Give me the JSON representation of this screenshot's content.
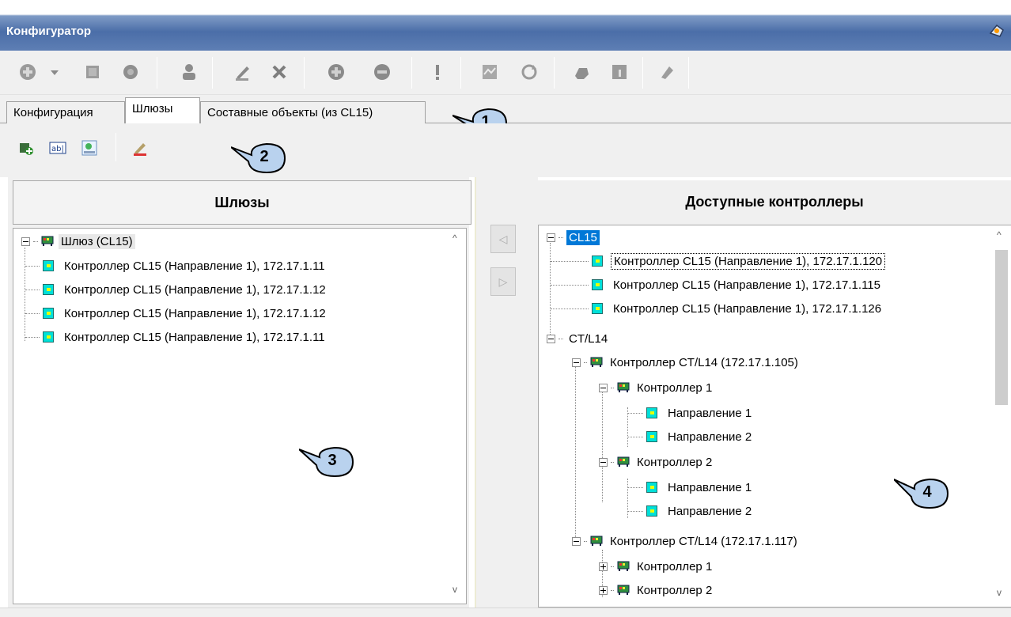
{
  "window": {
    "title": "Конфигуратор"
  },
  "tabs": [
    {
      "label": "Конфигурация",
      "active": false
    },
    {
      "label": "Шлюзы",
      "active": true
    },
    {
      "label": "Составные объекты (из CL15)",
      "active": false
    }
  ],
  "callouts": [
    "1",
    "2",
    "3",
    "4"
  ],
  "left_panel": {
    "header": "Шлюзы",
    "root": "Шлюз (CL15)",
    "items": [
      "Контроллер CL15 (Направление 1), 172.17.1.11",
      "Контроллер CL15 (Направление 1), 172.17.1.12",
      "Контроллер CL15 (Направление 1), 172.17.1.12",
      "Контроллер CL15 (Направление 1), 172.17.1.11"
    ]
  },
  "move_buttons": {
    "left": "◁",
    "right": "▷"
  },
  "right_panel": {
    "header": "Доступные контроллеры",
    "tree": {
      "cl15_group": "CL15",
      "cl15_items": [
        "Контроллер CL15 (Направление 1), 172.17.1.120",
        "Контроллер CL15 (Направление 1), 172.17.1.115",
        "Контроллер CL15 (Направление 1), 172.17.1.126"
      ],
      "ctl14_group": "CT/L14",
      "device1": "Контроллер CT/L14 (172.17.1.105)",
      "device1_ctrl1": "Контроллер 1",
      "device1_ctrl1_dir1": "Направление 1",
      "device1_ctrl1_dir2": "Направление 2",
      "device1_ctrl2": "Контроллер 2",
      "device1_ctrl2_dir1": "Направление 1",
      "device1_ctrl2_dir2": "Направление 2",
      "device2": "Контроллер CT/L14 (172.17.1.117)",
      "device2_ctrl1": "Контроллер 1",
      "device2_ctrl2": "Контроллер 2"
    }
  },
  "scroll": {
    "up": "^",
    "down": "v"
  },
  "colors": {
    "selection": "#0078d7",
    "titlebar": "#4b6ea8",
    "direction_icon": "#00e0d8"
  },
  "icons": {
    "toolbar": [
      "add-icon",
      "dropdown-arrow-icon",
      "module-icon",
      "gear-icon",
      "people-icon",
      "edit-icon",
      "delete-icon",
      "plus-circle-icon",
      "minus-circle-icon",
      "exclamation-icon",
      "map-icon",
      "refresh-icon",
      "hand-icon",
      "info-icon",
      "settings-icon"
    ],
    "subtoolbar": [
      "add-gateway-icon",
      "rename-icon",
      "properties-icon",
      "edit-icon"
    ]
  }
}
